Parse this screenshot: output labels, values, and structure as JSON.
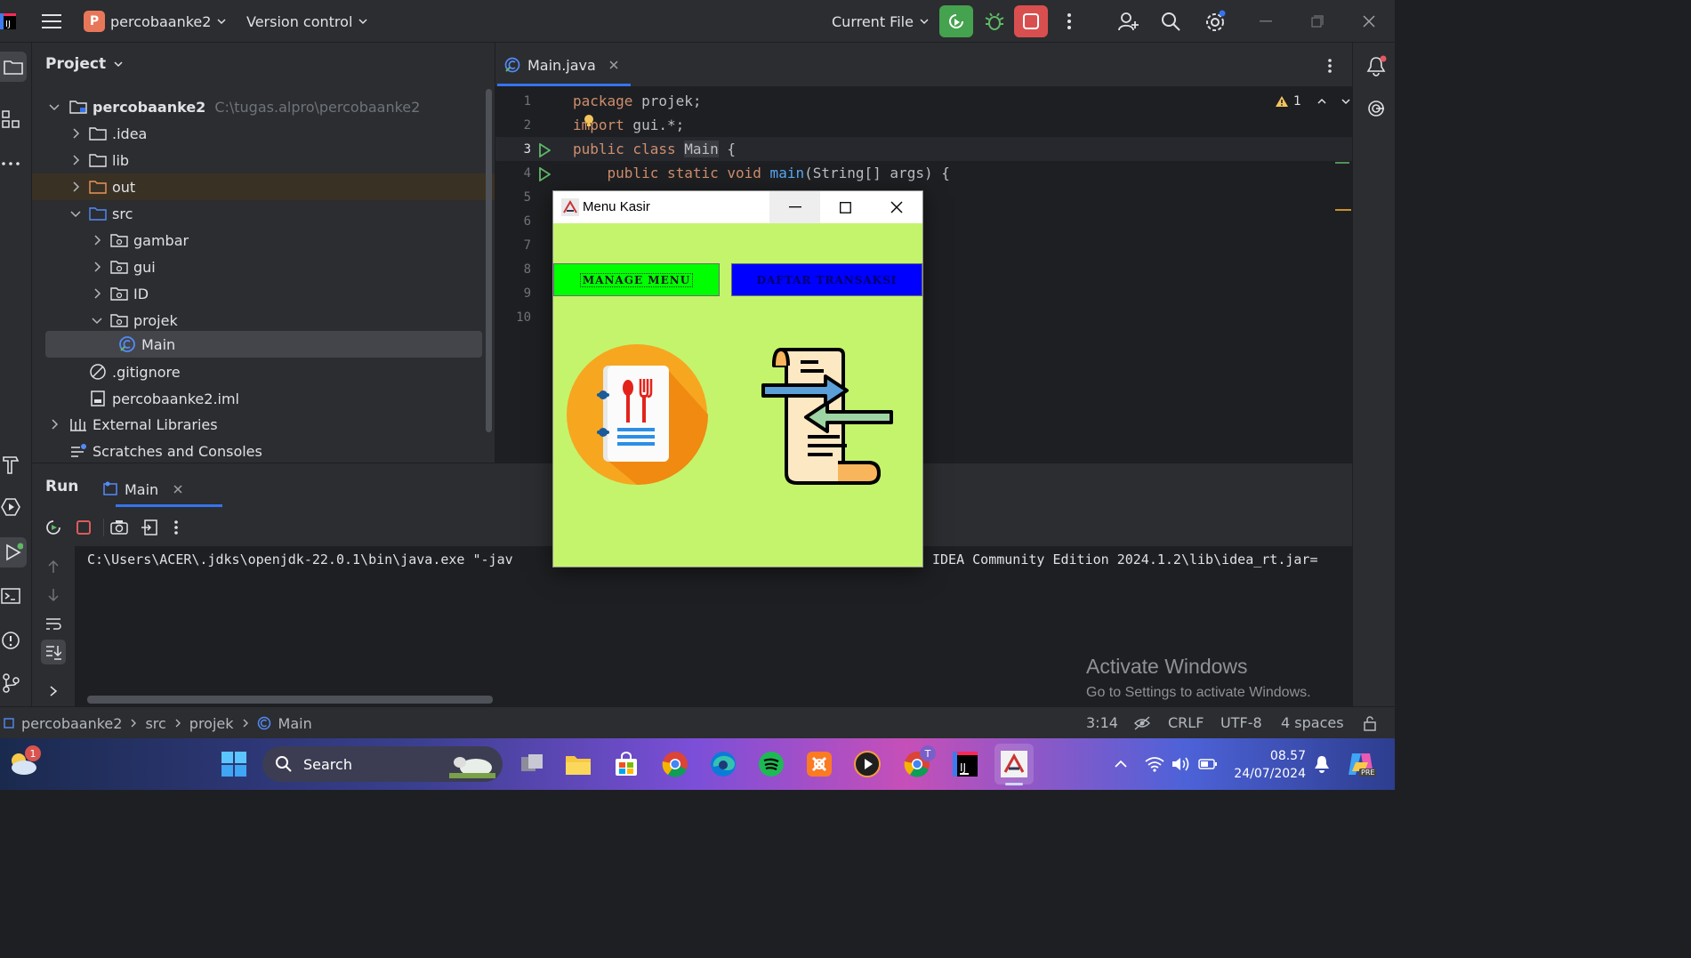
{
  "titlebar": {
    "project_badge": "P",
    "project_name": "percobaanke2",
    "vcs_label": "Version control",
    "run_config": "Current File"
  },
  "project_panel": {
    "title": "Project",
    "root_name": "percobaanke2",
    "root_path": "C:\\tugas.alpro\\percobaanke2",
    "items": [
      {
        "label": ".idea"
      },
      {
        "label": "lib"
      },
      {
        "label": "out"
      },
      {
        "label": "src"
      },
      {
        "label": "gambar"
      },
      {
        "label": "gui"
      },
      {
        "label": "ID"
      },
      {
        "label": "projek"
      },
      {
        "label": "Main"
      },
      {
        "label": ".gitignore"
      },
      {
        "label": "percobaanke2.iml"
      },
      {
        "label": "External Libraries"
      },
      {
        "label": "Scratches and Consoles"
      }
    ]
  },
  "editor": {
    "tab_label": "Main.java",
    "warning_count": "1",
    "line_numbers": [
      "1",
      "2",
      "3",
      "4",
      "5",
      "6",
      "7",
      "8",
      "9",
      "10"
    ],
    "lines": {
      "l1_kw": "package",
      "l1_rest": " projek;",
      "l2_kw": "import",
      "l2_rest": " gui.*;",
      "l3_kw": "public class",
      "l3_name": "Main",
      "l3_rest": " {",
      "l4_kw": "    public static void",
      "l4_fn": " main",
      "l4_rest": "(String[] args) {"
    }
  },
  "run_panel": {
    "title": "Run",
    "tab_label": "Main",
    "console_left": "C:\\Users\\ACER\\.jdks\\openjdk-22.0.1\\bin\\java.exe \"-jav",
    "console_right": "IDEA Community Edition 2024.1.2\\lib\\idea_rt.jar="
  },
  "swing_window": {
    "title": "Menu Kasir",
    "button_manage": "MANAGE MENU",
    "button_daftar": "DAFTAR TRANSAKSI",
    "background": "#c4f46c",
    "manage_color": "#00ff00",
    "daftar_color": "#0000ff"
  },
  "watermark": {
    "line1": "Activate Windows",
    "line2": "Go to Settings to activate Windows."
  },
  "statusbar": {
    "breadcrumb": [
      "percobaanke2",
      "src",
      "projek",
      "Main"
    ],
    "position": "3:14",
    "line_sep": "CRLF",
    "encoding": "UTF-8",
    "indent": "4 spaces"
  },
  "taskbar": {
    "weather_badge": "1",
    "search_label": "Search",
    "time": "08.57",
    "date": "24/07/2024",
    "chrome_profile": "T",
    "copilot_label": "PRE"
  }
}
